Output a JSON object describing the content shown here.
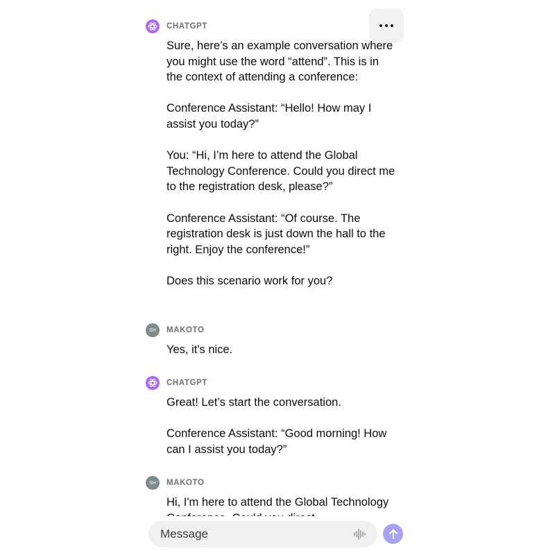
{
  "toolbar": {
    "more_icon": "more-horizontal-icon"
  },
  "messages": [
    {
      "sender": "CHATGPT",
      "avatar_icon": "openai-logo-icon",
      "paragraphs": [
        "Sure, here’s an example conversation where you might use the word “attend”. This is in the context of attending a conference:",
        "Conference Assistant: “Hello! How may I assist you today?”",
        "You: “Hi, I’m here to attend the Global Technology Conference. Could you direct me to the registration desk, please?”",
        "Conference Assistant: “Of course. The registration desk is just down the hall to the right. Enjoy the conference!”",
        "Does this scenario work for you?"
      ]
    },
    {
      "sender": "MAKOTO",
      "avatar_initials": "SH",
      "paragraphs": [
        "Yes, it's nice."
      ]
    },
    {
      "sender": "CHATGPT",
      "avatar_icon": "openai-logo-icon",
      "paragraphs": [
        "Great! Let’s start the conversation.",
        "Conference Assistant: “Good morning! How can I assist you today?”"
      ]
    },
    {
      "sender": "MAKOTO",
      "avatar_initials": "SH",
      "paragraphs": [
        "Hi, I'm here to attend the Global Technology Conference. Could you direct"
      ]
    }
  ],
  "composer": {
    "placeholder": "Message",
    "voice_icon": "waveform-icon",
    "send_icon": "arrow-up-icon",
    "send_color": "#a8a2f2"
  },
  "colors": {
    "bot_avatar": "#ab68ff",
    "user_avatar": "#7f8a8e"
  }
}
